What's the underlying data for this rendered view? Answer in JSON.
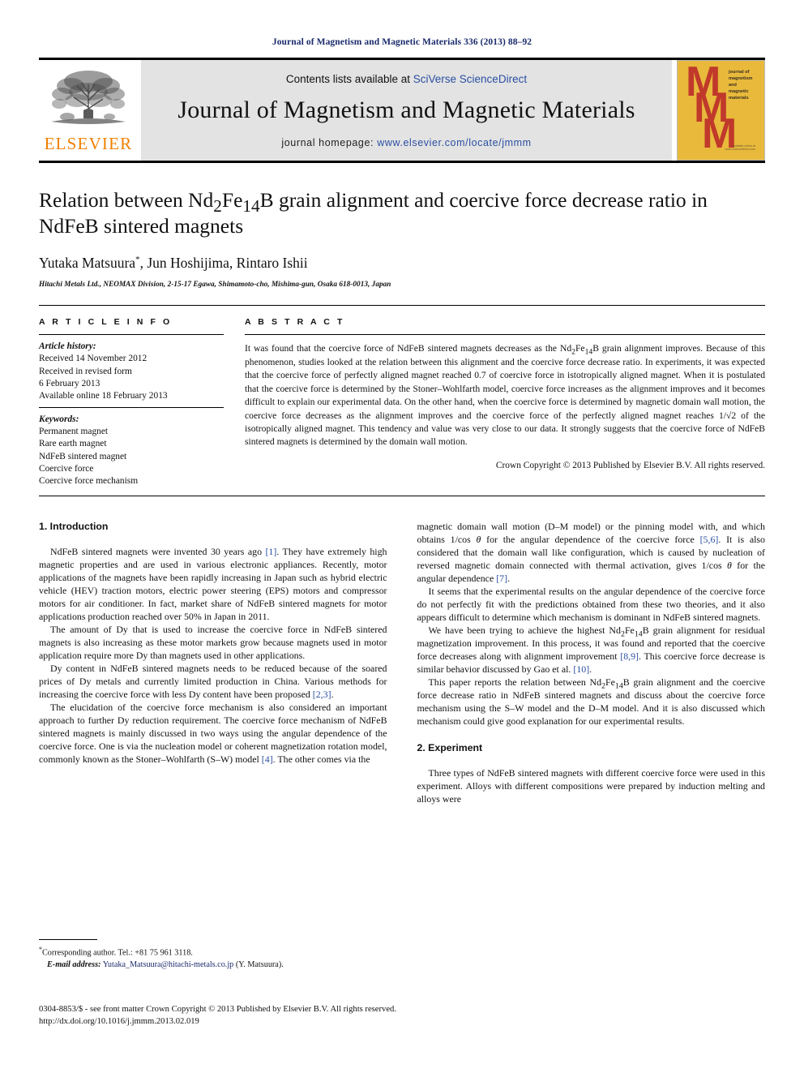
{
  "running_head": "Journal of Magnetism and Magnetic Materials 336 (2013) 88–92",
  "masthead": {
    "contents_prefix": "Contents lists available at",
    "contents_link": "SciVerse ScienceDirect",
    "journal_title": "Journal of Magnetism and Magnetic Materials",
    "homepage_prefix": "journal homepage:",
    "homepage_url": "www.elsevier.com/locate/jmmm",
    "publisher_wordmark": "ELSEVIER",
    "publisher_logo_icon": "elsevier-tree-icon",
    "cover": {
      "letters": "MMM",
      "side_text": "journal of magnetism and magnetic materials",
      "foot_text": "available online at www.sciencedirect.com",
      "background_color": "#E8B93B",
      "letter_color": "#C0392B"
    }
  },
  "title_block": {
    "title_line1_a": "Relation between Nd",
    "title_sub1": "2",
    "title_line1_b": "Fe",
    "title_sub2": "14",
    "title_line1_c": "B grain alignment and coercive force decrease ratio",
    "title_line2": "in NdFeB sintered magnets",
    "authors": "Yutaka Matsuura",
    "author_star": "*",
    "authors_rest": ", Jun Hoshijima, Rintaro Ishii",
    "affiliation": "Hitachi Metals Ltd., NEOMAX Division, 2-15-17 Egawa, Shimamoto-cho, Mishima-gun, Osaka 618-0013, Japan"
  },
  "article_info": {
    "heading": "A R T I C L E   I N F O",
    "history_label": "Article history:",
    "history": [
      "Received 14 November 2012",
      "Received in revised form",
      "6 February 2013",
      "Available online 18 February 2013"
    ],
    "keywords_label": "Keywords:",
    "keywords": [
      "Permanent magnet",
      "Rare earth magnet",
      "NdFeB sintered magnet",
      "Coercive force",
      "Coercive force mechanism"
    ]
  },
  "abstract": {
    "heading": "A B S T R A C T",
    "part1": "It was found that the coercive force of NdFeB sintered magnets decreases as the Nd",
    "sub1": "2",
    "part2": "Fe",
    "sub2": "14",
    "part3": "B grain alignment improves. Because of this phenomenon, studies looked at the relation between this alignment and the coercive force decrease ratio. In experiments, it was expected that the coercive force of perfectly aligned magnet reached 0.7 of coercive force in istotropically aligned magnet. When it is postulated that the coercive force is determined by the Stoner–Wohlfarth model, coercive force increases as the alignment improves and it becomes difficult to explain our experimental data. On the other hand, when the coercive force is determined by magnetic domain wall motion, the coercive force decreases as the alignment improves and the coercive force of the perfectly aligned magnet reaches",
    "fraction": "1/√2",
    "part4": "of the isotropically aligned magnet. This tendency and value was very close to our data. It strongly suggests that the coercive force of NdFeB sintered magnets is determined by the domain wall motion.",
    "copyright": "Crown Copyright © 2013 Published by Elsevier B.V. All rights reserved."
  },
  "sections": {
    "introduction_heading": "1.  Introduction",
    "experiment_heading": "2.  Experiment"
  },
  "left_column": {
    "p1_a": "NdFeB sintered magnets were invented 30 years ago ",
    "p1_cite1": "[1]",
    "p1_b": ". They have extremely high magnetic properties and are used in various electronic appliances. Recently, motor applications of the magnets have been rapidly increasing in Japan such as hybrid electric vehicle (HEV) traction motors, electric power steering (EPS) motors and compressor motors for air conditioner. In fact, market share of NdFeB sintered magnets for motor applications production reached over 50% in Japan in 2011.",
    "p2": "The amount of Dy that is used to increase the coercive force in NdFeB sintered magnets is also increasing as these motor markets grow because magnets used in motor application require more Dy than magnets used in other applications.",
    "p3_a": "Dy content in NdFeB sintered magnets needs to be reduced because of the soared prices of Dy metals and currently limited production in China. Various methods for increasing the coercive force with less Dy content have been proposed ",
    "p3_cite": "[2,3]",
    "p3_b": ".",
    "p4_a": "The elucidation of the coercive force mechanism is also considered an important approach to further Dy reduction requirement. The coercive force mechanism of NdFeB sintered magnets is mainly discussed in two ways using the angular dependence of the coercive force. One is via the nucleation model or coherent magnetization rotation model, commonly known as the Stoner–Wohlfarth (S–W) model ",
    "p4_cite": "[4]",
    "p4_b": ". The other comes via the"
  },
  "right_column": {
    "p1_a": "magnetic domain wall motion (D–M model) or the pinning model with, and which obtains 1/cos ",
    "p1_theta": "θ",
    "p1_b": " for the angular dependence of the coercive force ",
    "p1_cite1": "[5,6]",
    "p1_c": ". It is also considered that the domain wall like configuration, which is caused by nucleation of reversed magnetic domain connected with thermal activation, gives 1/cos ",
    "p1_theta2": "θ",
    "p1_d": " for the angular dependence ",
    "p1_cite2": "[7]",
    "p1_e": ".",
    "p2": "It seems that the experimental results on the angular dependence of the coercive force do not perfectly fit with the predictions obtained from these two theories, and it also appears difficult to determine which mechanism is dominant in NdFeB sintered magnets.",
    "p3_a": "We have been trying to achieve the highest Nd",
    "p3_sub1": "2",
    "p3_b": "Fe",
    "p3_sub2": "14",
    "p3_c": "B grain alignment for residual magnetization improvement. In this process, it was found and reported that the coercive force decreases along with alignment improvement ",
    "p3_cite1": "[8,9]",
    "p3_d": ". This coercive force decrease is similar behavior discussed by Gao et al. ",
    "p3_cite2": "[10]",
    "p3_e": ".",
    "p4_a": "This paper reports the relation between Nd",
    "p4_sub1": "2",
    "p4_b": "Fe",
    "p4_sub2": "14",
    "p4_c": "B grain alignment and the coercive force decrease ratio in NdFeB sintered magnets and discuss about the coercive force mechanism using the S–W model and the D–M model. And it is also discussed which mechanism could give good explanation for our experimental results.",
    "p5": "Three types of NdFeB sintered magnets with different coercive force were used in this experiment. Alloys with different compositions were prepared by induction melting and alloys were"
  },
  "footnote": {
    "star": "*",
    "corresponding": "Corresponding author. Tel.: +81 75 961 3118.",
    "email_label": "E-mail address:",
    "email": "Yutaka_Matsuura@hitachi-metals.co.jp",
    "email_suffix": "(Y. Matsuura)."
  },
  "page_footer": {
    "issn_line": "0304-8853/$ - see front matter Crown Copyright © 2013 Published by Elsevier B.V. All rights reserved.",
    "doi": "http://dx.doi.org/10.1016/j.jmmm.2013.02.019"
  }
}
